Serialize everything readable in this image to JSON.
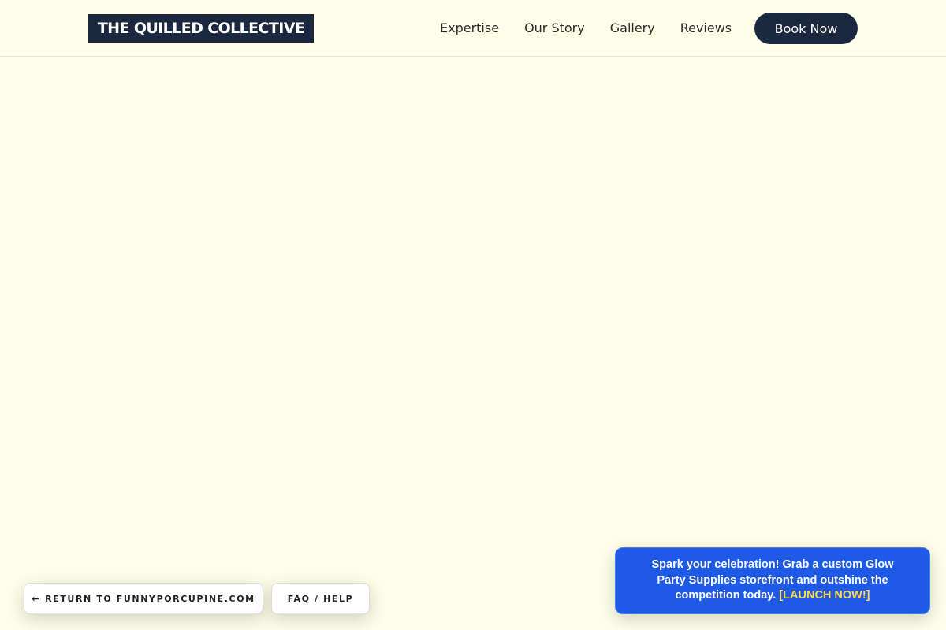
{
  "header": {
    "logo_text": "THE QUILLED COLLECTIVE",
    "nav": [
      {
        "label": "Expertise"
      },
      {
        "label": "Our Story"
      },
      {
        "label": "Gallery"
      },
      {
        "label": "Reviews"
      }
    ],
    "cta_label": "Book Now"
  },
  "footer_buttons": {
    "return_arrow": "←",
    "return_label": "RETURN TO FUNNYPORCUPINE.COM",
    "faq_label": "FAQ / HELP"
  },
  "promo": {
    "text": "Spark your celebration! Grab a custom Glow Party Supplies storefront and outshine the competition today.",
    "link_label": "[LAUNCH NOW!]"
  },
  "colors": {
    "background": "#fefee8",
    "brand_navy": "#1c2740",
    "promo_blue": "#1f5ae6",
    "promo_link": "#ffd84d"
  },
  "icons": {
    "return": "arrow-left-icon"
  }
}
